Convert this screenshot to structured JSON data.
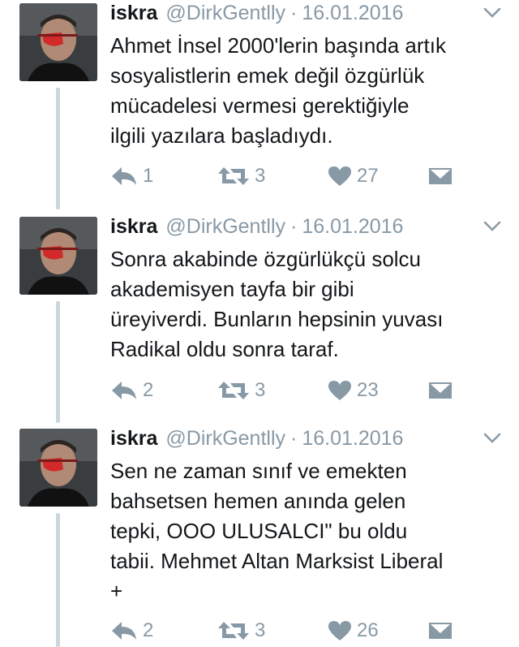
{
  "colors": {
    "muted": "#8899a6",
    "text": "#14171a",
    "thread": "#ccd6dd"
  },
  "tweets": [
    {
      "name": "iskra",
      "handle": "@DirkGentlly",
      "separator": "·",
      "date": "16.01.2016",
      "lines": [
        "Ahmet İnsel 2000'lerin başında artık",
        "sosyalistlerin emek değil özgürlük",
        "mücadelesi vermesi gerektiğiyle",
        "ilgili yazılara başladıydı."
      ],
      "replies": "1",
      "retweets": "3",
      "likes": "27"
    },
    {
      "name": "iskra",
      "handle": "@DirkGentlly",
      "separator": "·",
      "date": "16.01.2016",
      "lines": [
        "Sonra akabinde özgürlükçü solcu",
        "akademisyen tayfa bir gibi",
        "üreyiverdi. Bunların hepsinin yuvası",
        "Radikal oldu sonra taraf."
      ],
      "replies": "2",
      "retweets": "3",
      "likes": "23"
    },
    {
      "name": "iskra",
      "handle": "@DirkGentlly",
      "separator": "·",
      "date": "16.01.2016",
      "lines": [
        "Sen ne zaman sınıf ve emekten",
        "bahsetsen hemen anında gelen",
        "tepki, OOO ULUSALCI\" bu oldu",
        "tabii. Mehmet Altan Marksist Liberal",
        "+"
      ],
      "replies": "2",
      "retweets": "3",
      "likes": "26"
    }
  ]
}
